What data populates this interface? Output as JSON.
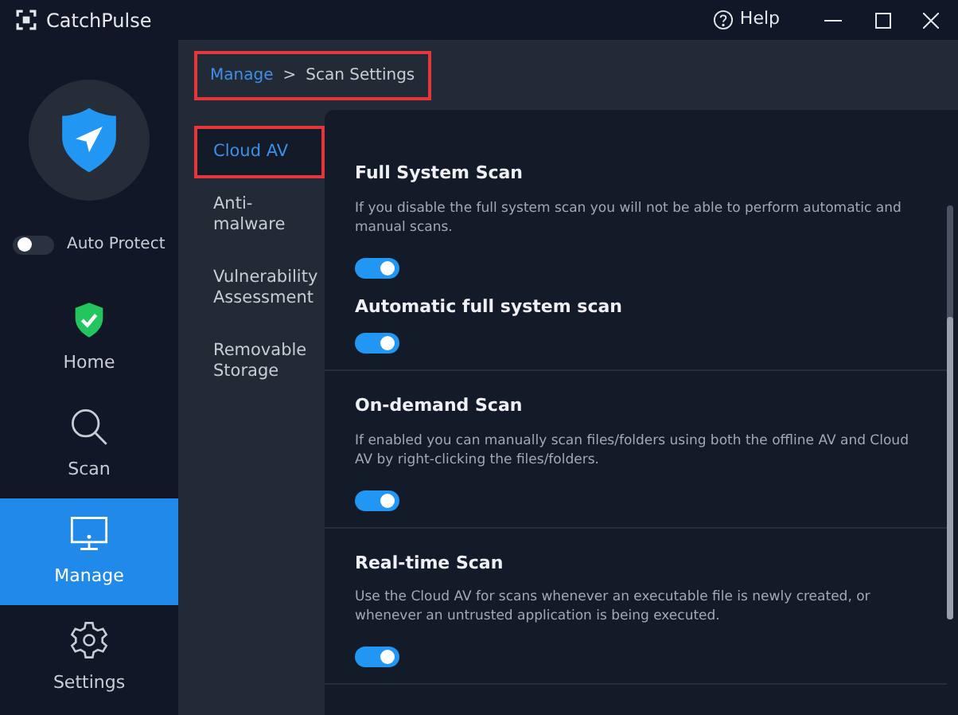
{
  "window": {
    "title": "CatchPulse",
    "help": "Help"
  },
  "auto_protect": {
    "label": "Auto Protect",
    "on": false
  },
  "nav": [
    {
      "label": "Home",
      "kind": "home",
      "selected": false
    },
    {
      "label": "Scan",
      "kind": "scan",
      "selected": false
    },
    {
      "label": "Manage",
      "kind": "manage",
      "selected": true
    },
    {
      "label": "Settings",
      "kind": "settings",
      "selected": false
    }
  ],
  "breadcrumb": {
    "items": [
      "Manage",
      "Scan Settings"
    ],
    "separator": ">",
    "highlighted": true
  },
  "submenu": [
    {
      "label": "Cloud AV",
      "selected": true,
      "highlighted": true
    },
    {
      "label": "Anti-malware",
      "selected": false,
      "highlighted": false
    },
    {
      "label": "Vulnerability Assessment",
      "selected": false,
      "highlighted": false
    },
    {
      "label": "Removable Storage",
      "selected": false,
      "highlighted": false
    }
  ],
  "sections": [
    {
      "settings": [
        {
          "title": "Full System Scan",
          "description": "If you disable the full system scan you will not be able to perform automatic and manual scans.",
          "on": true
        },
        {
          "title": "Automatic full system scan",
          "on": true
        }
      ]
    },
    {
      "settings": [
        {
          "title": "On-demand Scan",
          "description": "If enabled you can manually scan files/folders using both the offline AV and Cloud AV by right-clicking the files/folders.",
          "on": true
        }
      ]
    },
    {
      "settings": [
        {
          "title": "Real-time Scan",
          "description": "Use the Cloud AV for scans whenever an executable file is newly created, or whenever an untrusted application is being executed.",
          "on": true
        }
      ]
    }
  ]
}
